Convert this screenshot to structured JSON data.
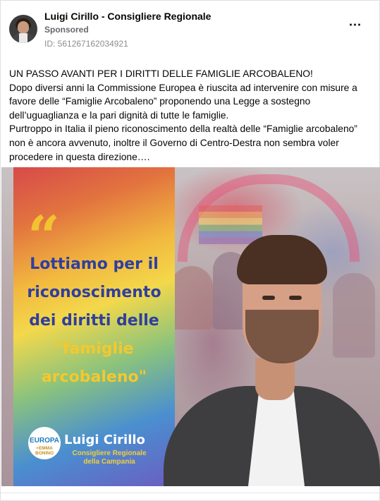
{
  "header": {
    "page_name": "Luigi Cirillo - Consigliere Regionale",
    "sponsored": "Sponsored",
    "ad_id": "ID: 561267162034921",
    "more_icon": "⋯"
  },
  "post": {
    "lines": [
      "UN PASSO AVANTI PER I DIRITTI DELLE FAMIGLIE ARCOBALENO!",
      "Dopo diversi anni la Commissione Europea è riuscita ad intervenire con misure a favore delle “Famiglie Arcobaleno” proponendo una Legge a sostegno dell’uguaglianza e la pari dignità di tutte le famiglie.",
      "Purtroppo in Italia il pieno riconoscimento della realtà delle “Famiglie arcobaleno” non è ancora avvenuto, inoltre il Governo di Centro-Destra non sembra voler procedere in questa direzione…."
    ]
  },
  "image": {
    "quote_mark": "“",
    "headline_lines": [
      "Lottiamo per il",
      "riconoscimento",
      "dei diritti delle"
    ],
    "headline_yellow_lines": [
      "\"famiglie",
      "arcobaleno\""
    ],
    "logo_top": "EUROPA",
    "logo_bottom": "+EMMA BONINO",
    "brand_name": "Luigi Cirillo",
    "brand_sub1": "Consigliere Regionale",
    "brand_sub2": "della Campania"
  },
  "colors": {
    "headline_blue": "#2f3f9e",
    "accent_yellow": "#f5c82d"
  }
}
